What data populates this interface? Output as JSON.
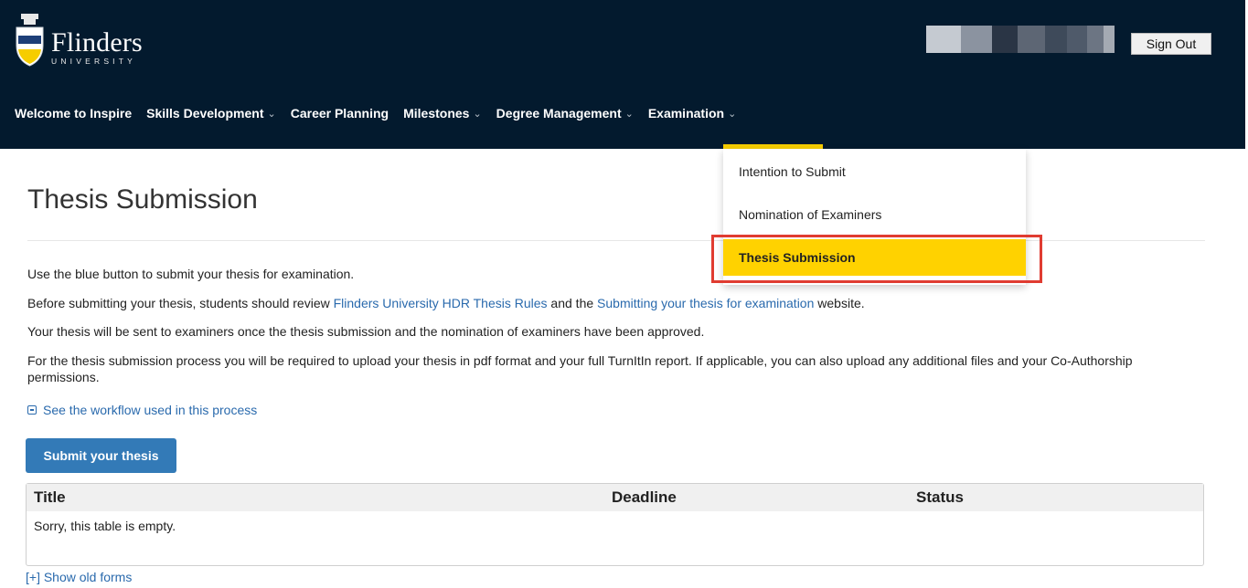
{
  "header": {
    "logo": {
      "name": "Flinders",
      "sub": "UNIVERSITY"
    },
    "user_blur_colors": [
      "#c5cad1",
      "#8b93a0",
      "#2a3545",
      "#5d6674",
      "#3e4a5a",
      "#4f5a6a",
      "#6c7583",
      "#a4aab3"
    ],
    "sign_out_label": "Sign Out"
  },
  "nav": {
    "items": [
      {
        "label": "Welcome to Inspire",
        "dropdown": false
      },
      {
        "label": "Skills Development",
        "dropdown": true
      },
      {
        "label": "Career Planning",
        "dropdown": false
      },
      {
        "label": "Milestones",
        "dropdown": true
      },
      {
        "label": "Degree Management",
        "dropdown": true
      },
      {
        "label": "Examination",
        "dropdown": true
      }
    ],
    "active": "Examination",
    "dropdown_items": [
      "Intention to Submit",
      "Nomination of Examiners",
      "Thesis Submission"
    ],
    "dropdown_selected": "Thesis Submission"
  },
  "page": {
    "title": "Thesis Submission",
    "p1": "Use the blue button to submit your thesis for examination.",
    "p2": {
      "pre": "Before submitting your thesis, students should review ",
      "link1": "Flinders University HDR Thesis Rules",
      "mid": " and the ",
      "link2": "Submitting your thesis for examination",
      "post": " website."
    },
    "p3": "Your thesis will be sent to examiners once the thesis submission and the nomination of examiners have been approved.",
    "p4": "For the thesis submission process you will be required to upload your thesis in pdf format and your full TurnItIn report. If applicable, you can also upload any additional files and your Co-Authorship permissions.",
    "workflow_link": "See the workflow used in this process",
    "submit_button": "Submit your thesis",
    "table": {
      "columns": [
        "Title",
        "Deadline",
        "Status"
      ],
      "empty_message": "Sorry, this table is empty."
    },
    "old_forms_link": "[+] Show old forms"
  },
  "colors": {
    "header_bg": "#031a2e",
    "accent_yellow": "#ffd200",
    "primary_blue": "#337ab7",
    "link_blue": "#2a6aad",
    "highlight_red": "#e03c31"
  }
}
